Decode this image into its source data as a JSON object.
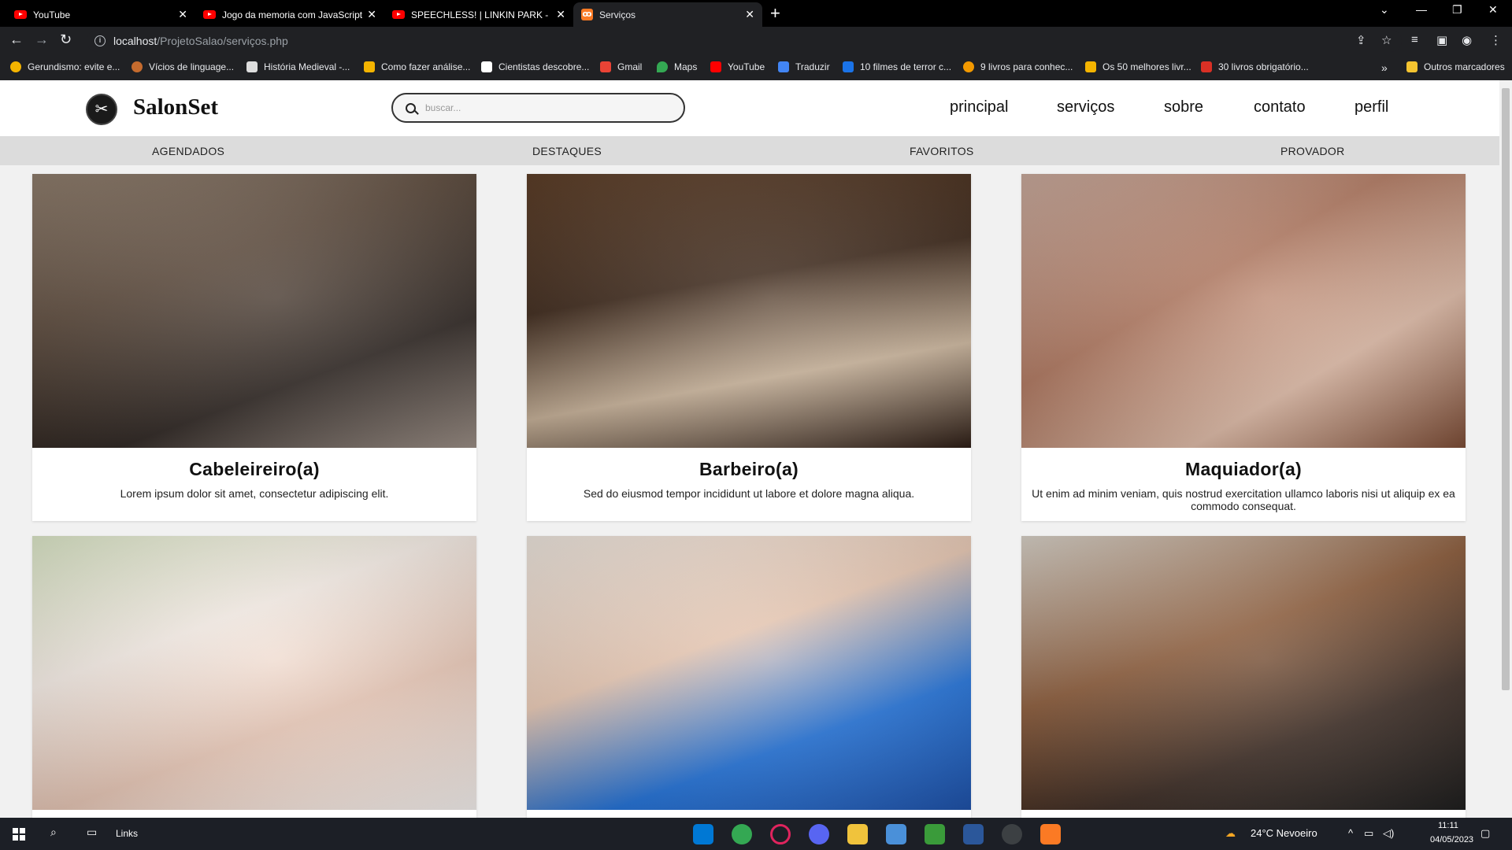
{
  "browser": {
    "tabs": [
      {
        "title": "YouTube",
        "favicon": "youtube-icon"
      },
      {
        "title": "Jogo da memoria com JavaScript",
        "favicon": "youtube-icon"
      },
      {
        "title": "SPEECHLESS! | LINKIN PARK - FIG",
        "favicon": "youtube-icon"
      },
      {
        "title": "Serviços",
        "favicon": "xampp-icon"
      }
    ],
    "url_host": "localhost",
    "url_path": "/ProjetoSalao/serviços.php",
    "bookmarks": [
      {
        "label": "Gerundismo: evite e...",
        "color": "#f4b400"
      },
      {
        "label": "Vícios de linguage...",
        "color": "#c56b2e"
      },
      {
        "label": "História Medieval -...",
        "color": "#dddddd"
      },
      {
        "label": "Como fazer análise...",
        "color": "#f4b400"
      },
      {
        "label": "Cientistas descobre...",
        "color": "#ffffff"
      },
      {
        "label": "Gmail",
        "color": "#ea4335"
      },
      {
        "label": "Maps",
        "color": "#34a853"
      },
      {
        "label": "YouTube",
        "color": "#ff0000"
      },
      {
        "label": "Traduzir",
        "color": "#4285f4"
      },
      {
        "label": "10 filmes de terror c...",
        "color": "#1a73e8"
      },
      {
        "label": "9 livros para conhec...",
        "color": "#f29900"
      },
      {
        "label": "Os 50 melhores livr...",
        "color": "#f4b400"
      },
      {
        "label": "30 livros obrigatório...",
        "color": "#d93025"
      }
    ],
    "bookmarks_overflow": "»",
    "other_bookmarks": "Outros marcadores"
  },
  "site": {
    "brand": "SalonSet",
    "search_placeholder": "buscar...",
    "nav": [
      "principal",
      "serviços",
      "sobre",
      "contato",
      "perfil"
    ],
    "subnav": [
      "AGENDADOS",
      "DESTAQUES",
      "FAVORITOS",
      "PROVADOR"
    ],
    "cards": [
      {
        "title": "Cabeleireiro(a)",
        "desc": "Lorem ipsum dolor sit amet, consectetur adipiscing elit."
      },
      {
        "title": "Barbeiro(a)",
        "desc": "Sed do eiusmod tempor incididunt ut labore et dolore magna aliqua."
      },
      {
        "title": "Maquiador(a)",
        "desc": "Ut enim ad minim veniam, quis nostrud exercitation ullamco laboris nisi ut aliquip ex ea commodo consequat."
      },
      {
        "title": "",
        "desc": ""
      },
      {
        "title": "",
        "desc": ""
      },
      {
        "title": "",
        "desc": ""
      }
    ]
  },
  "taskbar": {
    "links_label": "Links",
    "weather": "24°C  Nevoeiro",
    "time": "11:11",
    "date": "04/05/2023"
  }
}
